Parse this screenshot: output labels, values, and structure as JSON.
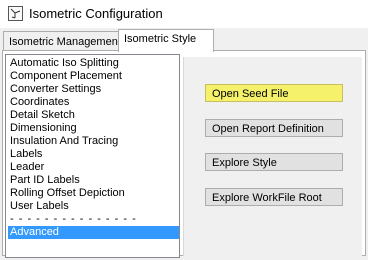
{
  "window": {
    "title": "Isometric Configuration",
    "icon": "application-icon"
  },
  "tabs": [
    {
      "label": "Isometric Management",
      "active": false
    },
    {
      "label": "Isometric Style",
      "active": true
    }
  ],
  "list": {
    "items": [
      "Automatic Iso Splitting",
      "Component Placement",
      "Converter Settings",
      "Coordinates",
      "Detail Sketch",
      "Dimensioning",
      "Insulation And Tracing",
      "Labels",
      "Leader",
      "Part ID Labels",
      "Rolling Offset Depiction",
      "User Labels"
    ],
    "separator": "- - - - - - - - - - - - - - -",
    "selected_item": "Advanced"
  },
  "buttons": {
    "open_seed_file": "Open Seed File",
    "open_report_definition": "Open Report Definition",
    "explore_style": "Explore Style",
    "explore_workfile_root": "Explore WorkFile Root"
  },
  "colors": {
    "selection": "#3399ff",
    "highlight_button": "#f5f16b"
  }
}
